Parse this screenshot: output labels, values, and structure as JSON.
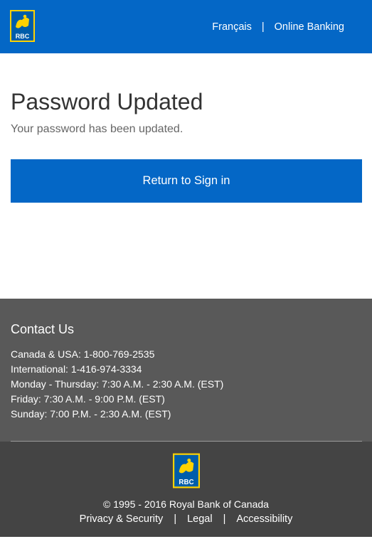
{
  "header": {
    "logo_text": "RBC",
    "nav": [
      {
        "label": "Français"
      },
      {
        "label": "Online Banking"
      }
    ],
    "separator": "|"
  },
  "main": {
    "title": "Password Updated",
    "message": "Your password has been updated.",
    "button_label": "Return to Sign in"
  },
  "contact": {
    "heading": "Contact Us",
    "lines": [
      "Canada & USA: 1-800-769-2535",
      "International: 1-416-974-3334",
      "Monday - Thursday: 7:30 A.M. - 2:30 A.M. (EST)",
      "Friday: 7:30 A.M. - 9:00 P.M. (EST)",
      "Sunday: 7:00 P.M. - 2:30 A.M. (EST)"
    ]
  },
  "footer": {
    "logo_text": "RBC",
    "copyright": "© 1995 - 2016 Royal Bank of Canada",
    "links": [
      {
        "label": "Privacy & Security"
      },
      {
        "label": "Legal"
      },
      {
        "label": "Accessibility"
      }
    ],
    "separator": "|"
  },
  "colors": {
    "brand_blue": "#0467c6",
    "brand_yellow": "#ffd200",
    "contact_bg": "#595959",
    "footer_bg": "#444444"
  }
}
